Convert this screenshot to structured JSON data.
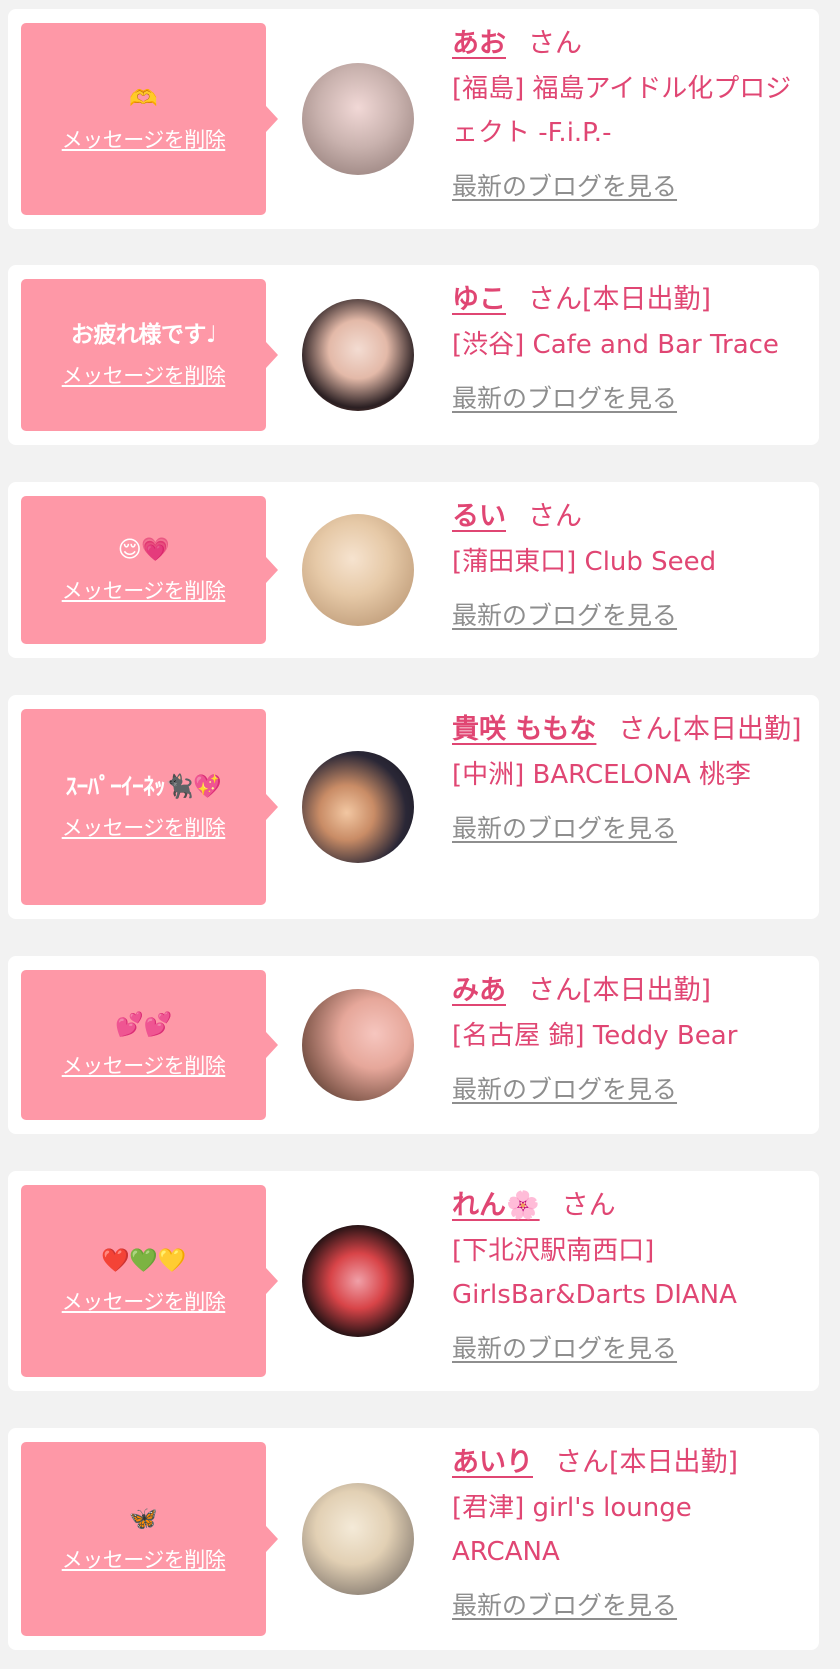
{
  "common": {
    "delete_label": "メッセージを削除",
    "blog_label": "最新のブログを見る",
    "san_label": "さん"
  },
  "colors": {
    "page_background": "#f2f2f2",
    "card_background": "#ffffff",
    "bubble_background": "#fe98a7",
    "name_text": "#e04673",
    "link_gray": "#8e8e8e"
  },
  "cards": [
    {
      "message": "🫶",
      "name": "あお",
      "suffix": "",
      "shop": "[福島] 福島アイドル化プロジェクト -F.i.P.-",
      "avatar": "avatar-photo-1"
    },
    {
      "message": "お疲れ様です♩",
      "name": "ゆこ",
      "suffix": "[本日出勤]",
      "shop": "[渋谷] Cafe and Bar Trace",
      "avatar": "avatar-photo-2"
    },
    {
      "message": "😌💗",
      "name": "るい",
      "suffix": "",
      "shop": "[蒲田東口] Club Seed",
      "avatar": "avatar-photo-3"
    },
    {
      "message": "ｽｰﾊﾟｰｲｰﾈｯ🐈‍⬛💖",
      "name": "貴咲 ももな",
      "suffix": "[本日出勤]",
      "shop": "[中洲] BARCELONA 桃李",
      "avatar": "avatar-photo-4"
    },
    {
      "message": "💕💕",
      "name": "みあ",
      "suffix": "[本日出勤]",
      "shop": "[名古屋 錦] Teddy Bear",
      "avatar": "avatar-photo-5"
    },
    {
      "message": "❤️💚💛",
      "name": "れん🌸",
      "suffix": "",
      "shop": "[下北沢駅南西口] GirlsBar&Darts DIANA",
      "avatar": "avatar-photo-6"
    },
    {
      "message": "🦋",
      "name": "あいり",
      "suffix": "[本日出勤]",
      "shop": "[君津] girl's lounge ARCANA",
      "avatar": "avatar-photo-7"
    }
  ]
}
